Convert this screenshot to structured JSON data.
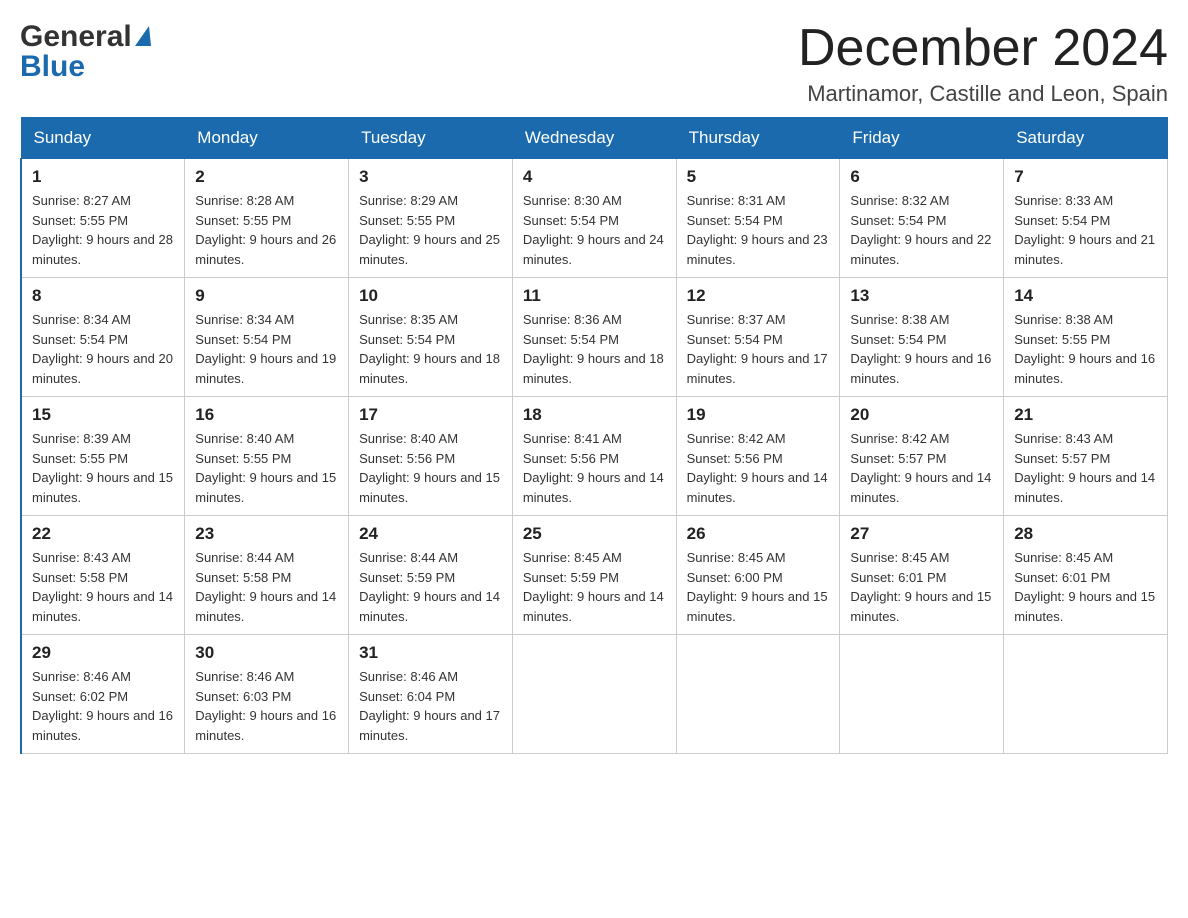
{
  "header": {
    "logo_general": "General",
    "logo_blue": "Blue",
    "month_title": "December 2024",
    "subtitle": "Martinamor, Castille and Leon, Spain"
  },
  "days_of_week": [
    "Sunday",
    "Monday",
    "Tuesday",
    "Wednesday",
    "Thursday",
    "Friday",
    "Saturday"
  ],
  "weeks": [
    [
      {
        "day": "1",
        "sunrise": "8:27 AM",
        "sunset": "5:55 PM",
        "daylight": "9 hours and 28 minutes."
      },
      {
        "day": "2",
        "sunrise": "8:28 AM",
        "sunset": "5:55 PM",
        "daylight": "9 hours and 26 minutes."
      },
      {
        "day": "3",
        "sunrise": "8:29 AM",
        "sunset": "5:55 PM",
        "daylight": "9 hours and 25 minutes."
      },
      {
        "day": "4",
        "sunrise": "8:30 AM",
        "sunset": "5:54 PM",
        "daylight": "9 hours and 24 minutes."
      },
      {
        "day": "5",
        "sunrise": "8:31 AM",
        "sunset": "5:54 PM",
        "daylight": "9 hours and 23 minutes."
      },
      {
        "day": "6",
        "sunrise": "8:32 AM",
        "sunset": "5:54 PM",
        "daylight": "9 hours and 22 minutes."
      },
      {
        "day": "7",
        "sunrise": "8:33 AM",
        "sunset": "5:54 PM",
        "daylight": "9 hours and 21 minutes."
      }
    ],
    [
      {
        "day": "8",
        "sunrise": "8:34 AM",
        "sunset": "5:54 PM",
        "daylight": "9 hours and 20 minutes."
      },
      {
        "day": "9",
        "sunrise": "8:34 AM",
        "sunset": "5:54 PM",
        "daylight": "9 hours and 19 minutes."
      },
      {
        "day": "10",
        "sunrise": "8:35 AM",
        "sunset": "5:54 PM",
        "daylight": "9 hours and 18 minutes."
      },
      {
        "day": "11",
        "sunrise": "8:36 AM",
        "sunset": "5:54 PM",
        "daylight": "9 hours and 18 minutes."
      },
      {
        "day": "12",
        "sunrise": "8:37 AM",
        "sunset": "5:54 PM",
        "daylight": "9 hours and 17 minutes."
      },
      {
        "day": "13",
        "sunrise": "8:38 AM",
        "sunset": "5:54 PM",
        "daylight": "9 hours and 16 minutes."
      },
      {
        "day": "14",
        "sunrise": "8:38 AM",
        "sunset": "5:55 PM",
        "daylight": "9 hours and 16 minutes."
      }
    ],
    [
      {
        "day": "15",
        "sunrise": "8:39 AM",
        "sunset": "5:55 PM",
        "daylight": "9 hours and 15 minutes."
      },
      {
        "day": "16",
        "sunrise": "8:40 AM",
        "sunset": "5:55 PM",
        "daylight": "9 hours and 15 minutes."
      },
      {
        "day": "17",
        "sunrise": "8:40 AM",
        "sunset": "5:56 PM",
        "daylight": "9 hours and 15 minutes."
      },
      {
        "day": "18",
        "sunrise": "8:41 AM",
        "sunset": "5:56 PM",
        "daylight": "9 hours and 14 minutes."
      },
      {
        "day": "19",
        "sunrise": "8:42 AM",
        "sunset": "5:56 PM",
        "daylight": "9 hours and 14 minutes."
      },
      {
        "day": "20",
        "sunrise": "8:42 AM",
        "sunset": "5:57 PM",
        "daylight": "9 hours and 14 minutes."
      },
      {
        "day": "21",
        "sunrise": "8:43 AM",
        "sunset": "5:57 PM",
        "daylight": "9 hours and 14 minutes."
      }
    ],
    [
      {
        "day": "22",
        "sunrise": "8:43 AM",
        "sunset": "5:58 PM",
        "daylight": "9 hours and 14 minutes."
      },
      {
        "day": "23",
        "sunrise": "8:44 AM",
        "sunset": "5:58 PM",
        "daylight": "9 hours and 14 minutes."
      },
      {
        "day": "24",
        "sunrise": "8:44 AM",
        "sunset": "5:59 PM",
        "daylight": "9 hours and 14 minutes."
      },
      {
        "day": "25",
        "sunrise": "8:45 AM",
        "sunset": "5:59 PM",
        "daylight": "9 hours and 14 minutes."
      },
      {
        "day": "26",
        "sunrise": "8:45 AM",
        "sunset": "6:00 PM",
        "daylight": "9 hours and 15 minutes."
      },
      {
        "day": "27",
        "sunrise": "8:45 AM",
        "sunset": "6:01 PM",
        "daylight": "9 hours and 15 minutes."
      },
      {
        "day": "28",
        "sunrise": "8:45 AM",
        "sunset": "6:01 PM",
        "daylight": "9 hours and 15 minutes."
      }
    ],
    [
      {
        "day": "29",
        "sunrise": "8:46 AM",
        "sunset": "6:02 PM",
        "daylight": "9 hours and 16 minutes."
      },
      {
        "day": "30",
        "sunrise": "8:46 AM",
        "sunset": "6:03 PM",
        "daylight": "9 hours and 16 minutes."
      },
      {
        "day": "31",
        "sunrise": "8:46 AM",
        "sunset": "6:04 PM",
        "daylight": "9 hours and 17 minutes."
      },
      null,
      null,
      null,
      null
    ]
  ]
}
